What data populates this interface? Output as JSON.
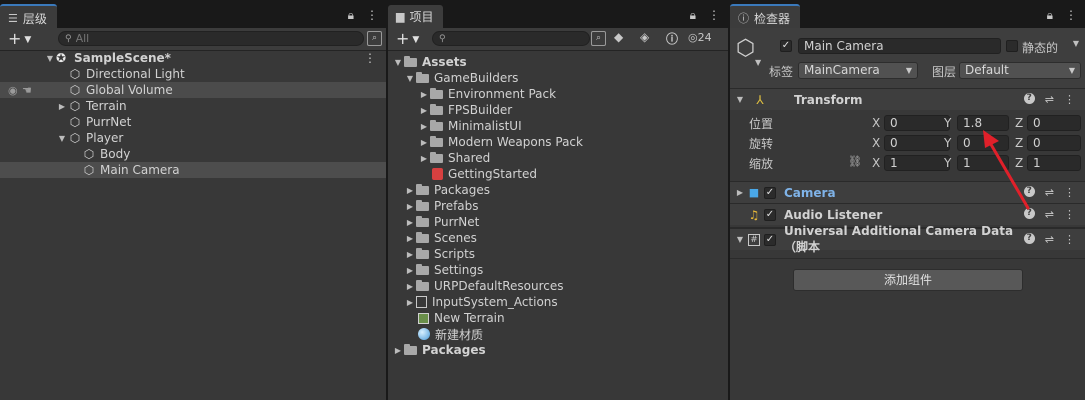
{
  "hierarchy": {
    "tab_label": "层级",
    "search_placeholder": "All",
    "items": [
      {
        "label": "SampleScene*"
      },
      {
        "label": "Directional Light"
      },
      {
        "label": "Global Volume"
      },
      {
        "label": "Terrain"
      },
      {
        "label": "PurrNet"
      },
      {
        "label": "Player"
      },
      {
        "label": "Body"
      },
      {
        "label": "Main Camera"
      }
    ]
  },
  "project": {
    "tab_label": "项目",
    "hidden_count": "24",
    "items": [
      {
        "label": "Assets"
      },
      {
        "label": "GameBuilders"
      },
      {
        "label": "Environment Pack"
      },
      {
        "label": "FPSBuilder"
      },
      {
        "label": "MinimalistUI"
      },
      {
        "label": "Modern Weapons Pack"
      },
      {
        "label": "Shared"
      },
      {
        "label": "GettingStarted"
      },
      {
        "label": "Packages"
      },
      {
        "label": "Prefabs"
      },
      {
        "label": "PurrNet"
      },
      {
        "label": "Scenes"
      },
      {
        "label": "Scripts"
      },
      {
        "label": "Settings"
      },
      {
        "label": "URPDefaultResources"
      },
      {
        "label": "InputSystem_Actions"
      },
      {
        "label": "New Terrain"
      },
      {
        "label": "新建材质"
      },
      {
        "label": "Packages"
      }
    ]
  },
  "inspector": {
    "tab_label": "检查器",
    "object_name": "Main Camera",
    "static_label": "静态的",
    "tag_label": "标签",
    "tag_value": "MainCamera",
    "layer_label": "图层",
    "layer_value": "Default",
    "transform": {
      "title": "Transform",
      "position_label": "位置",
      "rotation_label": "旋转",
      "scale_label": "缩放",
      "axis_x": "X",
      "axis_y": "Y",
      "axis_z": "Z",
      "position": [
        "0",
        "1.8",
        "0"
      ],
      "rotation": [
        "0",
        "0",
        "0"
      ],
      "scale": [
        "1",
        "1",
        "1"
      ]
    },
    "components": [
      {
        "title": "Camera"
      },
      {
        "title": "Audio Listener"
      },
      {
        "title": "Universal Additional Camera Data（脚本"
      }
    ],
    "add_component_label": "添加组件"
  },
  "colors": {
    "accent_blue": "#3a79bb",
    "camera_title": "#7fb3e8",
    "annotation_arrow": "#e0202a"
  }
}
